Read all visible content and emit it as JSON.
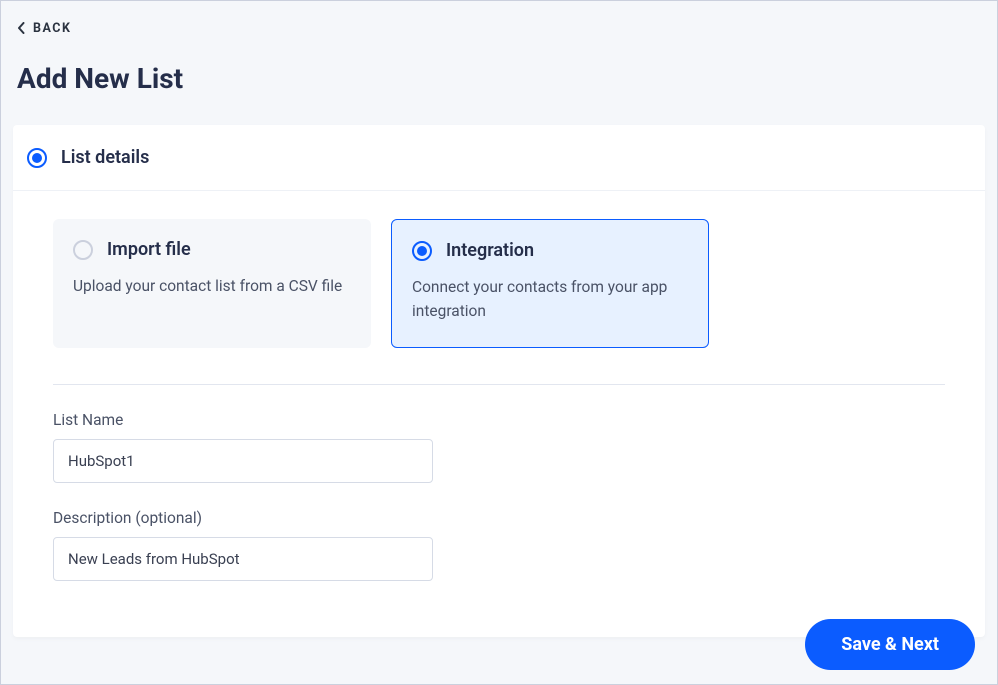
{
  "back_label": "BACK",
  "page_title": "Add New List",
  "step": {
    "title": "List details",
    "selected": true
  },
  "options": {
    "import": {
      "title": "Import file",
      "desc": "Upload your contact list from a CSV file",
      "selected": false
    },
    "integration": {
      "title": "Integration",
      "desc": "Connect your contacts from your app integration",
      "selected": true
    }
  },
  "form": {
    "list_name_label": "List Name",
    "list_name_value": "HubSpot1",
    "description_label": "Description (optional)",
    "description_value": "New Leads from HubSpot"
  },
  "buttons": {
    "save_next": "Save & Next"
  }
}
